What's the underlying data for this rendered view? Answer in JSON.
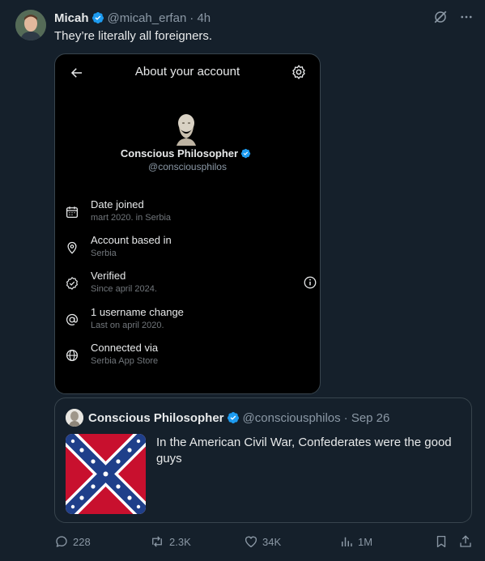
{
  "post": {
    "author_name": "Micah",
    "author_handle": "@micah_erfan",
    "time": "· 4h",
    "text": "They’re literally all foreigners."
  },
  "media": {
    "title": "About your account",
    "profile_name": "Conscious Philosopher",
    "profile_handle": "@consciousphilos",
    "rows": [
      {
        "icon": "calendar-icon",
        "label": "Date joined",
        "sub": "mart 2020. in Serbia"
      },
      {
        "icon": "location-pin-icon",
        "label": "Account based in",
        "sub": "Serbia"
      },
      {
        "icon": "verified-check-icon",
        "label": "Verified",
        "sub": "Since april 2024."
      },
      {
        "icon": "at-sign-icon",
        "label": "1 username change",
        "sub": "Last on april 2020."
      },
      {
        "icon": "globe-icon",
        "label": "Connected via",
        "sub": "Serbia App Store"
      }
    ]
  },
  "quote": {
    "author_name": "Conscious Philosopher",
    "author_handle": "@consciousphilos",
    "time": "· Sep 26",
    "text": "In the American Civil War, Confederates were the good guys"
  },
  "actions": {
    "replies": "228",
    "reposts": "2.3K",
    "likes": "34K",
    "views": "1M"
  },
  "colors": {
    "background": "#15202b",
    "verified_blue": "#1d9bf0",
    "muted_text": "#8b98a5",
    "border": "#38444d"
  }
}
